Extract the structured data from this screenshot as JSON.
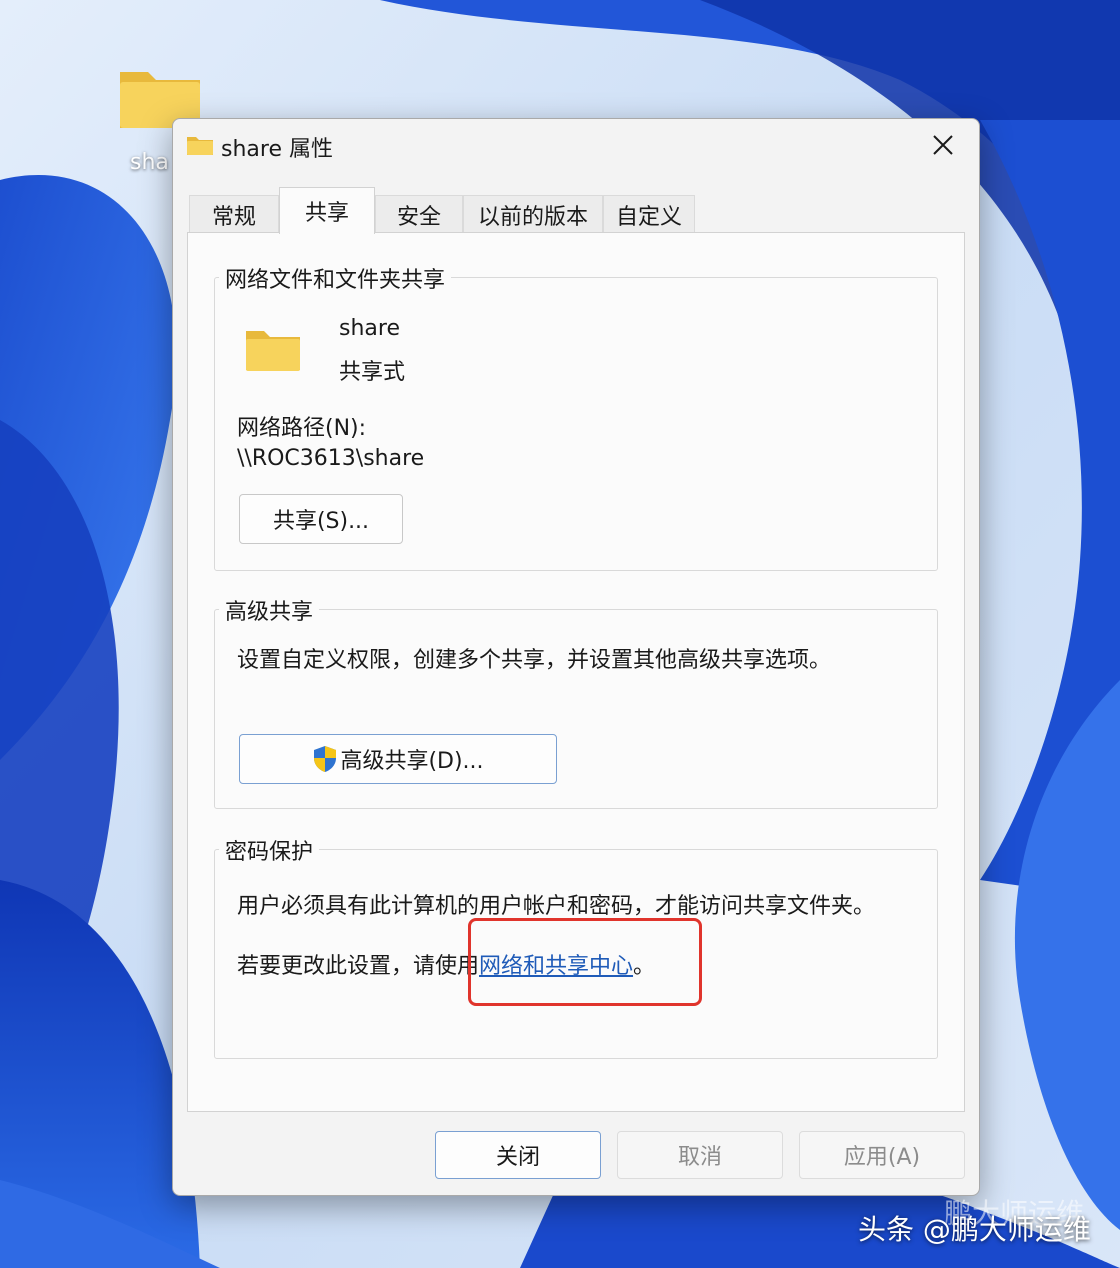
{
  "desktop": {
    "folder_label": "sha"
  },
  "dialog": {
    "title": "share 属性",
    "tabs": [
      "常规",
      "共享",
      "安全",
      "以前的版本",
      "自定义"
    ],
    "active_tab": "共享",
    "network_sharing": {
      "group_title": "网络文件和文件夹共享",
      "folder_name": "share",
      "folder_status": "共享式",
      "path_label": "网络路径(N):",
      "path_value": "\\\\ROC3613\\share",
      "share_button": "共享(S)..."
    },
    "advanced_sharing": {
      "group_title": "高级共享",
      "description": "设置自定义权限，创建多个共享，并设置其他高级共享选项。",
      "button": "高级共享(D)..."
    },
    "password_protection": {
      "group_title": "密码保护",
      "description": "用户必须具有此计算机的用户帐户和密码，才能访问共享文件夹。",
      "change_prefix": "若要更改此设置，请使用",
      "link": "网络和共享中心",
      "change_suffix": "。"
    },
    "footer": {
      "close": "关闭",
      "cancel": "取消",
      "apply": "应用(A)"
    }
  },
  "watermark": {
    "text": "头条 @鹏大师运维",
    "ghost": "鹏大师运维"
  },
  "colors": {
    "link": "#1f5bb8",
    "highlight": "#e0342c",
    "folder": "#f7d35c"
  }
}
